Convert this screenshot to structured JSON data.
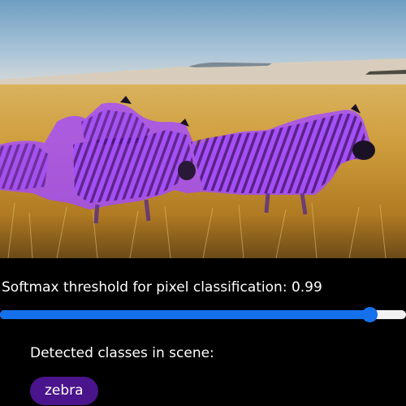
{
  "camera": {
    "scene": "zebras in savanna grass",
    "overlay_class": "zebra",
    "overlay_color": "#a24cff"
  },
  "threshold": {
    "label": "Softmax threshold for pixel classification: 0.99",
    "value": 0.99,
    "slider_fraction": 0.91,
    "track_color": "#f2f2f2",
    "fill_color": "#1570ec"
  },
  "detected": {
    "heading": "Detected classes in scene:",
    "classes": [
      {
        "label": "zebra",
        "color": "#4a148c"
      }
    ]
  }
}
